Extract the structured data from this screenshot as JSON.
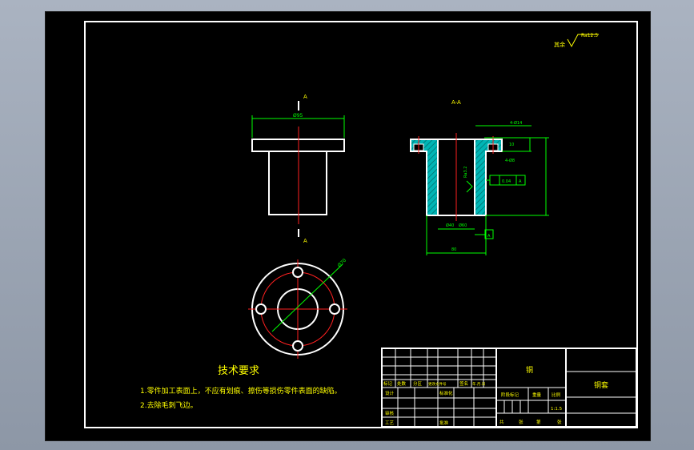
{
  "colors": {
    "background": "#000000",
    "outline": "#ffffff",
    "centerline": "#ff2020",
    "dimension": "#00ff00",
    "hatch": "#00c8c8",
    "notes": "#ffff00",
    "frame": "#a8b1bf"
  },
  "roughness_note": {
    "label": "其余",
    "value": "Ra12.5"
  },
  "section_labels": {
    "top": "A",
    "bottom": "A",
    "title": "A-A"
  },
  "front_view": {
    "top_diameter": "Ø95"
  },
  "section_view": {
    "dims": [
      "4-Ø14",
      "10",
      "4-Ø8",
      "0.04",
      "A",
      "Ra3.2",
      "Ø40",
      "Ø60",
      "A",
      "80"
    ]
  },
  "top_view": {
    "bolt_circle": "Ø70"
  },
  "tech_requirements": {
    "title": "技术要求",
    "items": [
      "1.零件加工表面上，不应有划痕、擦伤等损伤零件表面的缺陷。",
      "2.去除毛刺飞边。"
    ]
  },
  "title_block": {
    "material": "铜",
    "part_name": "铜套",
    "row_headers": [
      "标记",
      "处数",
      "分区",
      "更改文件号",
      "签名",
      "年.月.日"
    ],
    "designer_label": "设计",
    "standardization_label": "标准化",
    "stage_label": "阶段标记",
    "weight_label": "重量",
    "scale_label": "比例",
    "scale": "1:1.5",
    "review_label": "审核",
    "process_label": "工艺",
    "approve_label": "批准",
    "sheets_total_label": "共",
    "sheets_label": "张",
    "sheet_no_label": "第",
    "sheet_suffix_label": "张"
  }
}
